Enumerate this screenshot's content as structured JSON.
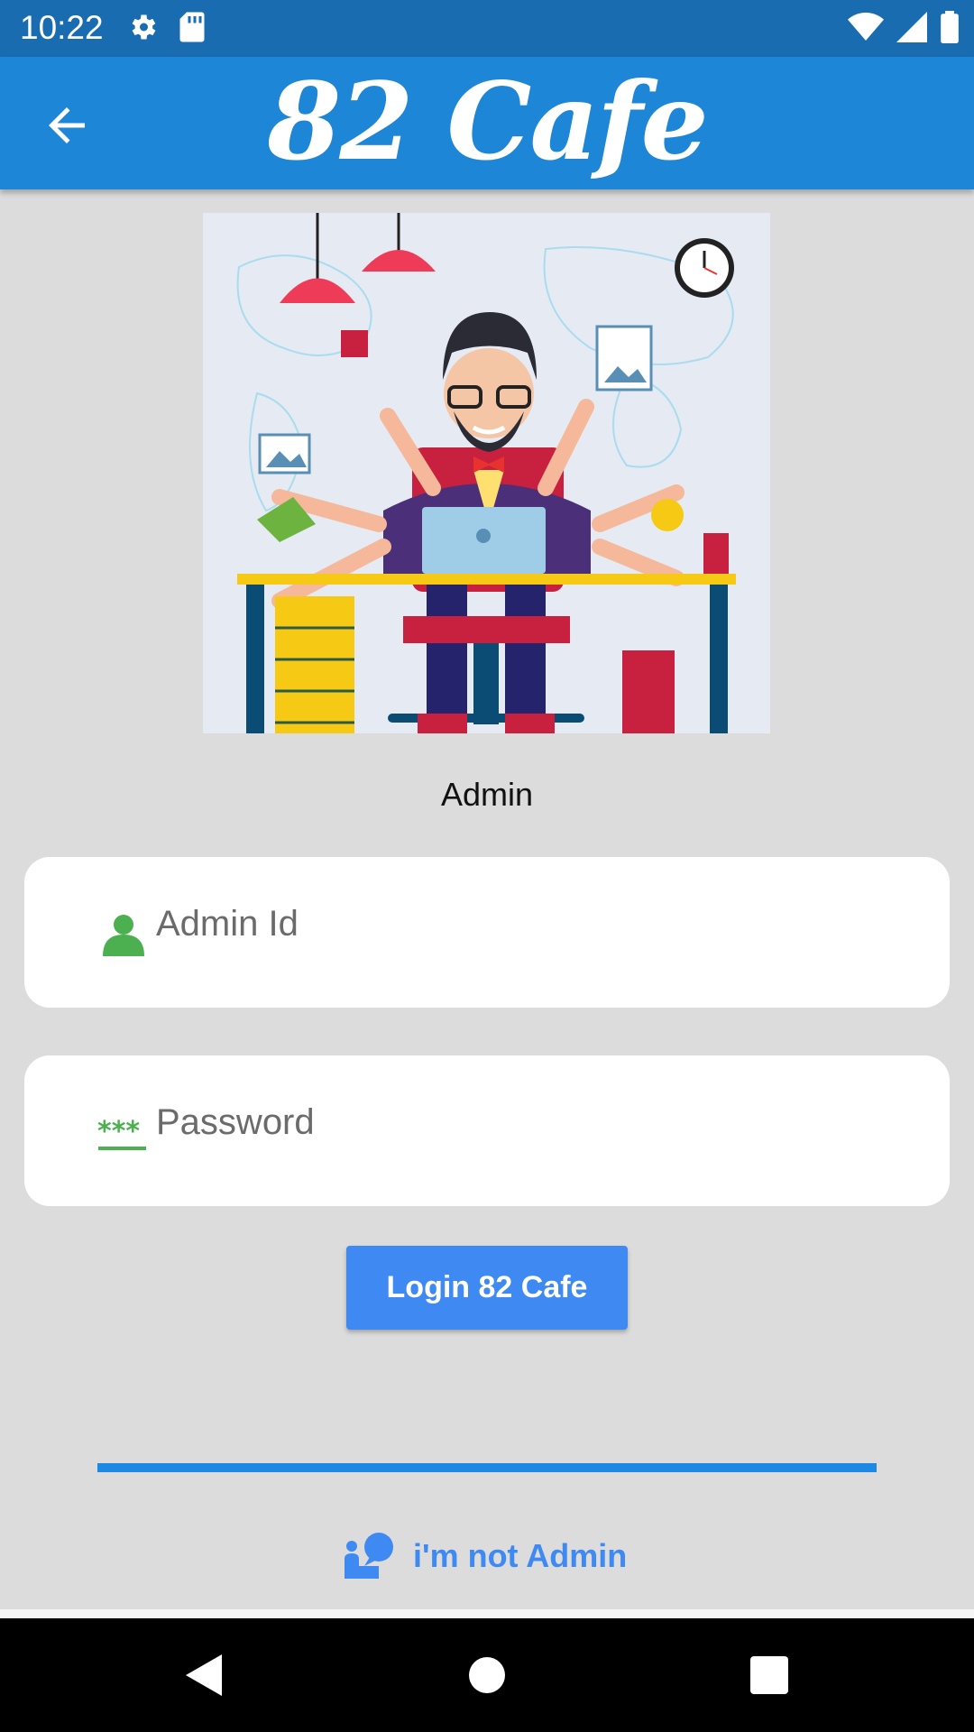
{
  "status_bar": {
    "time": "10:22",
    "icons": [
      "gear-icon",
      "sd-card-icon",
      "wifi-icon",
      "signal-icon",
      "battery-icon"
    ]
  },
  "app_bar": {
    "title": "82 Cafe",
    "back_icon": "arrow-left-icon",
    "color": "#1e86d6"
  },
  "hero": {
    "illustration": "multitasking-admin-illustration"
  },
  "role_label": "Admin",
  "form": {
    "admin_id": {
      "placeholder": "Admin Id",
      "value": "",
      "icon": "person-icon"
    },
    "password": {
      "placeholder": "Password",
      "value": "",
      "icon": "password-icon"
    },
    "login_button": "Login 82 Cafe"
  },
  "switch_role": {
    "label": "i'm not Admin",
    "icon": "user-speech-icon"
  },
  "colors": {
    "accent": "#3f8af2",
    "icon_green": "#4caf50",
    "background": "#dcdcdc"
  },
  "nav_bar": {
    "icons": [
      "back-triangle-icon",
      "home-circle-icon",
      "recents-square-icon"
    ]
  }
}
